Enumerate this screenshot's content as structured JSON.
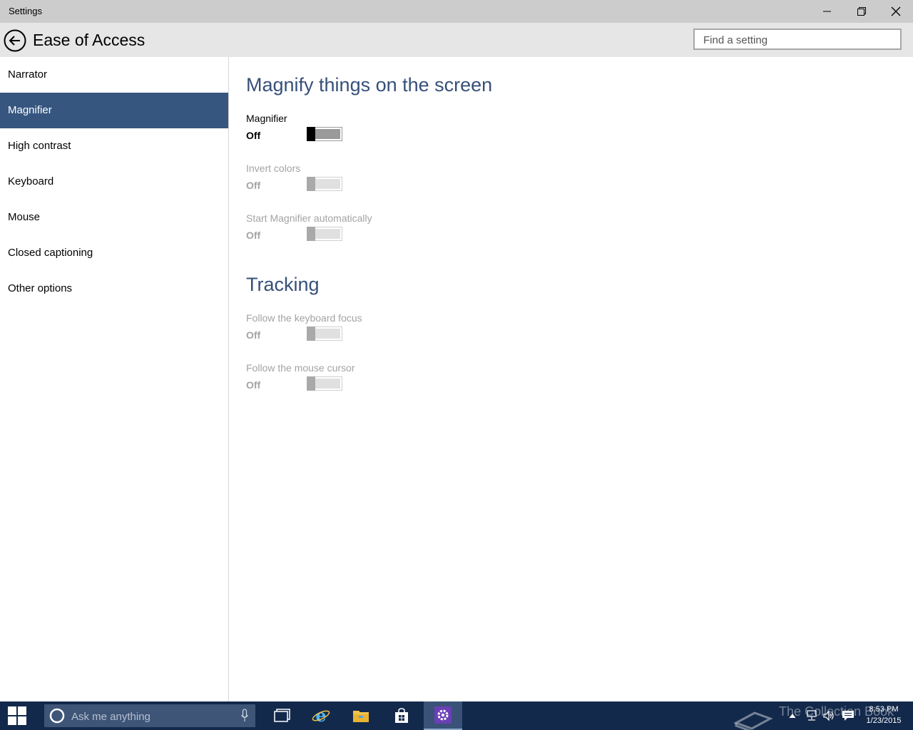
{
  "window": {
    "title": "Settings"
  },
  "header": {
    "page_title": "Ease of Access",
    "search_placeholder": "Find a setting"
  },
  "sidebar": {
    "items": [
      {
        "label": "Narrator"
      },
      {
        "label": "Magnifier"
      },
      {
        "label": "High contrast"
      },
      {
        "label": "Keyboard"
      },
      {
        "label": "Mouse"
      },
      {
        "label": "Closed captioning"
      },
      {
        "label": "Other options"
      }
    ],
    "selected": "Magnifier"
  },
  "content": {
    "section1_title": "Magnify things on the screen",
    "magnifier": {
      "label": "Magnifier",
      "state": "Off"
    },
    "invert_colors": {
      "label": "Invert colors",
      "state": "Off"
    },
    "start_auto": {
      "label": "Start Magnifier automatically",
      "state": "Off"
    },
    "section2_title": "Tracking",
    "keyboard_focus": {
      "label": "Follow the keyboard focus",
      "state": "Off"
    },
    "mouse_cursor": {
      "label": "Follow the mouse cursor",
      "state": "Off"
    }
  },
  "taskbar": {
    "search_placeholder": "Ask me anything",
    "time": "8:53 PM",
    "date": "1/23/2015",
    "watermark": "The Collection Book"
  },
  "colors": {
    "accent": "#365680",
    "section_title": "#37507a",
    "taskbar": "#13294b",
    "titlebar": "#cccccc",
    "header": "#e6e6e6"
  }
}
